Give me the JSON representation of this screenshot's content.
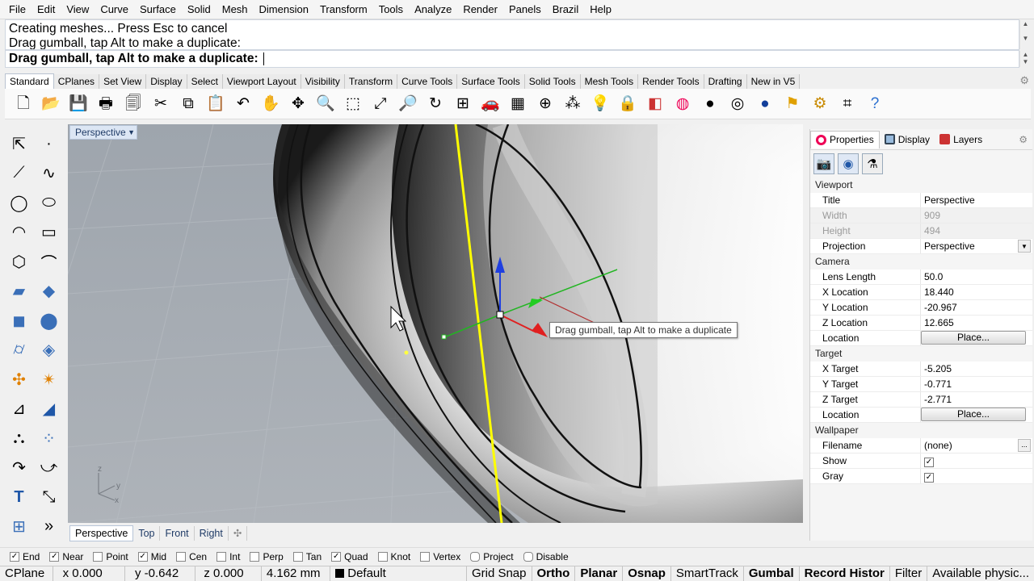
{
  "menu": [
    "File",
    "Edit",
    "View",
    "Curve",
    "Surface",
    "Solid",
    "Mesh",
    "Dimension",
    "Transform",
    "Tools",
    "Analyze",
    "Render",
    "Panels",
    "Brazil",
    "Help"
  ],
  "command": {
    "history": [
      "Creating meshes... Press Esc to cancel",
      "Drag gumball, tap Alt to make a duplicate:"
    ],
    "prompt": "Drag gumball, tap Alt to make a duplicate:"
  },
  "toolbar_tabs": [
    "Standard",
    "CPlanes",
    "Set View",
    "Display",
    "Select",
    "Viewport Layout",
    "Visibility",
    "Transform",
    "Curve Tools",
    "Surface Tools",
    "Solid Tools",
    "Mesh Tools",
    "Render Tools",
    "Drafting",
    "New in V5"
  ],
  "viewport": {
    "title": "Perspective",
    "tooltip": "Drag gumball, tap Alt to make a duplicate",
    "tabs": [
      "Perspective",
      "Top",
      "Front",
      "Right"
    ],
    "axes": {
      "z": "z",
      "y": "y",
      "x": "x"
    }
  },
  "panel": {
    "tabs": [
      "Properties",
      "Display",
      "Layers"
    ],
    "sections": {
      "viewport": "Viewport",
      "camera": "Camera",
      "target": "Target",
      "wallpaper": "Wallpaper"
    },
    "viewport_props": [
      {
        "k": "Title",
        "v": "Perspective"
      },
      {
        "k": "Width",
        "v": "909"
      },
      {
        "k": "Height",
        "v": "494"
      },
      {
        "k": "Projection",
        "v": "Perspective"
      }
    ],
    "camera_props": [
      {
        "k": "Lens Length",
        "v": "50.0"
      },
      {
        "k": "X Location",
        "v": "18.440"
      },
      {
        "k": "Y Location",
        "v": "-20.967"
      },
      {
        "k": "Z Location",
        "v": "12.665"
      },
      {
        "k": "Location",
        "v": "Place..."
      }
    ],
    "target_props": [
      {
        "k": "X Target",
        "v": "-5.205"
      },
      {
        "k": "Y Target",
        "v": "-0.771"
      },
      {
        "k": "Z Target",
        "v": "-2.771"
      },
      {
        "k": "Location",
        "v": "Place..."
      }
    ],
    "wallpaper_props": [
      {
        "k": "Filename",
        "v": "(none)"
      },
      {
        "k": "Show",
        "v": "✓"
      },
      {
        "k": "Gray",
        "v": "✓"
      }
    ]
  },
  "osnaps": [
    {
      "label": "End",
      "checked": true
    },
    {
      "label": "Near",
      "checked": true
    },
    {
      "label": "Point",
      "checked": false
    },
    {
      "label": "Mid",
      "checked": true
    },
    {
      "label": "Cen",
      "checked": false
    },
    {
      "label": "Int",
      "checked": false
    },
    {
      "label": "Perp",
      "checked": false
    },
    {
      "label": "Tan",
      "checked": false
    },
    {
      "label": "Quad",
      "checked": true
    },
    {
      "label": "Knot",
      "checked": false
    },
    {
      "label": "Vertex",
      "checked": false
    },
    {
      "label": "Project",
      "checked": false
    },
    {
      "label": "Disable",
      "checked": false
    }
  ],
  "status": {
    "cplane": "CPlane",
    "x": "x 0.000",
    "y": "y -0.642",
    "z": "z 0.000",
    "dist": "4.162 mm",
    "layer": "Default",
    "grid": "Grid Snap",
    "ortho": "Ortho",
    "planar": "Planar",
    "osnap": "Osnap",
    "smarttrack": "SmartTrack",
    "gumball": "Gumbal",
    "record": "Record Histor",
    "filter": "Filter",
    "physical": "Available physic..."
  }
}
